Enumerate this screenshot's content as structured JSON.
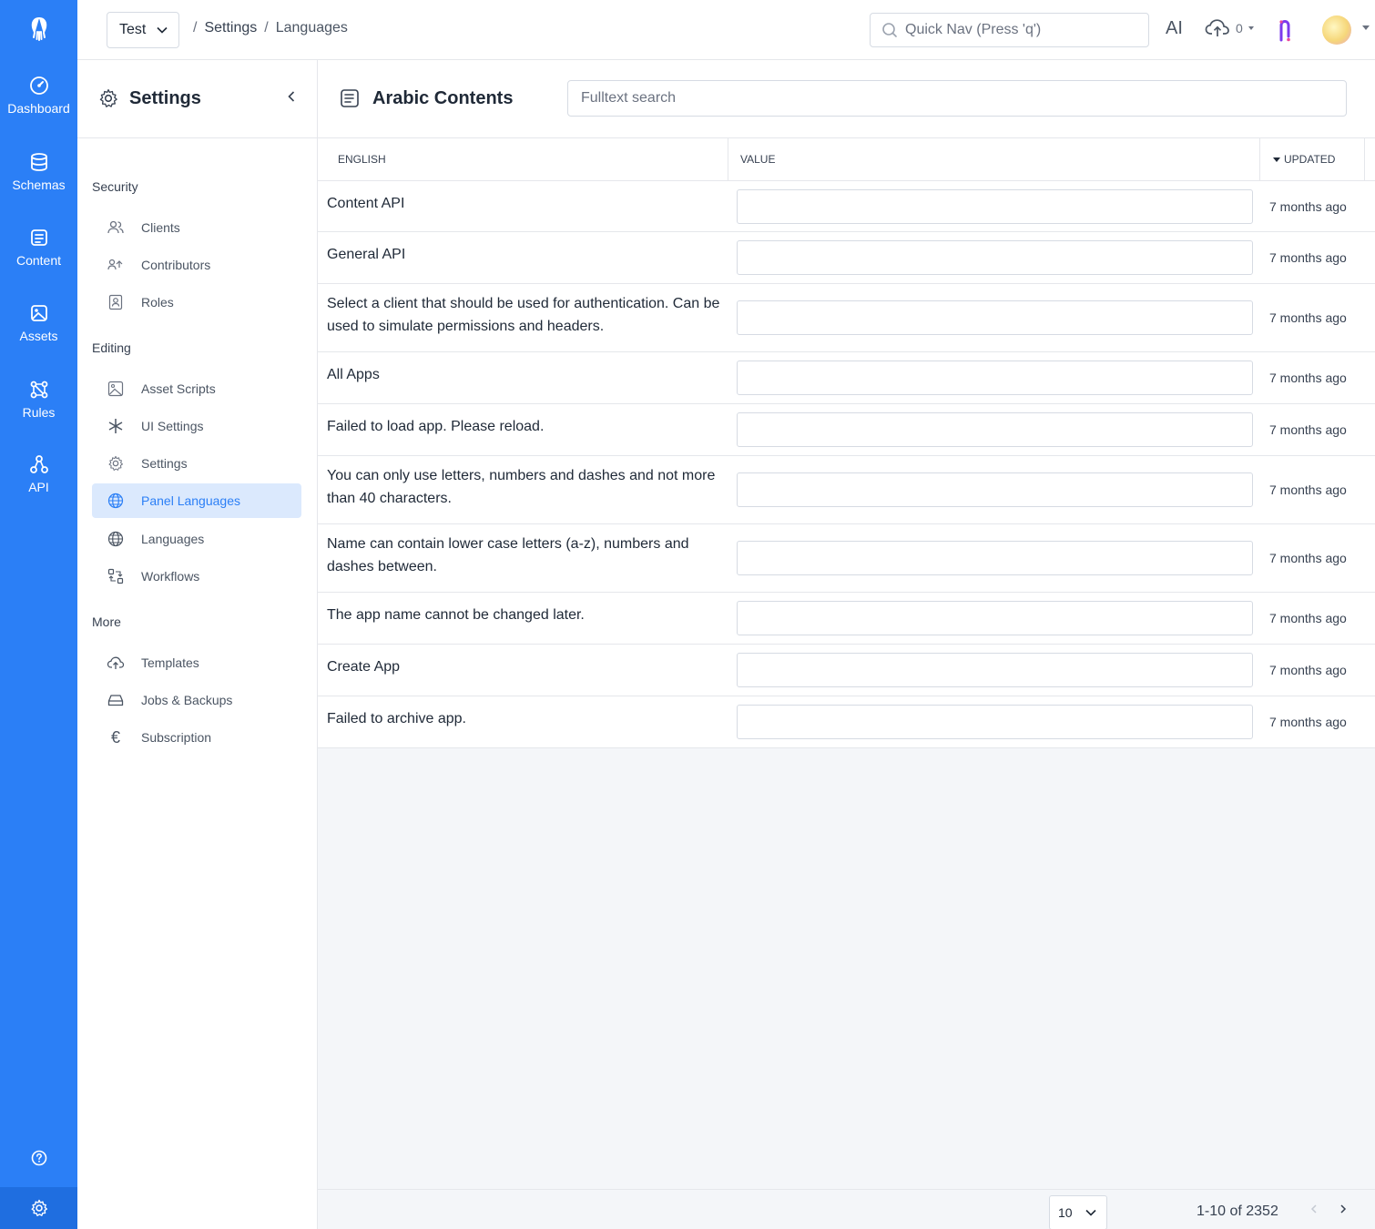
{
  "rail": {
    "items": [
      {
        "label": "Dashboard",
        "icon": "dashboard-icon"
      },
      {
        "label": "Schemas",
        "icon": "schemas-icon"
      },
      {
        "label": "Content",
        "icon": "content-icon"
      },
      {
        "label": "Assets",
        "icon": "assets-icon"
      },
      {
        "label": "Rules",
        "icon": "rules-icon"
      },
      {
        "label": "API",
        "icon": "api-icon"
      }
    ]
  },
  "topbar": {
    "app_name": "Test",
    "breadcrumb": {
      "sep": "/",
      "section": "Settings",
      "page": "Languages"
    },
    "quicknav_placeholder": "Quick Nav (Press 'q')",
    "ai_label": "AI",
    "upload_count": "0"
  },
  "sidebar": {
    "title": "Settings",
    "groups": [
      {
        "label": "Security"
      },
      {
        "label": "Editing"
      },
      {
        "label": "More"
      }
    ],
    "items": [
      {
        "label": "Clients"
      },
      {
        "label": "Contributors"
      },
      {
        "label": "Roles"
      },
      {
        "label": "Asset Scripts"
      },
      {
        "label": "UI Settings"
      },
      {
        "label": "Settings"
      },
      {
        "label": "Panel Languages"
      },
      {
        "label": "Languages"
      },
      {
        "label": "Workflows"
      },
      {
        "label": "Templates"
      },
      {
        "label": "Jobs & Backups"
      },
      {
        "label": "Subscription"
      }
    ]
  },
  "main": {
    "title": "Arabic Contents",
    "search_placeholder": "Fulltext search",
    "columns": {
      "english": "English",
      "value": "Value",
      "updated": "Updated"
    },
    "rows": [
      {
        "english": "Content API",
        "value": "",
        "updated": "7 months ago"
      },
      {
        "english": "General API",
        "value": "",
        "updated": "7 months ago"
      },
      {
        "english": "Select a client that should be used for authentication. Can be used to simulate permissions and headers.",
        "value": "",
        "updated": "7 months ago"
      },
      {
        "english": "All Apps",
        "value": "",
        "updated": "7 months ago"
      },
      {
        "english": "Failed to load app. Please reload.",
        "value": "",
        "updated": "7 months ago"
      },
      {
        "english": "You can only use letters, numbers and dashes and not more than 40 characters.",
        "value": "",
        "updated": "7 months ago"
      },
      {
        "english": "Name can contain lower case letters (a-z), numbers and dashes between.",
        "value": "",
        "updated": "7 months ago"
      },
      {
        "english": "The app name cannot be changed later.",
        "value": "",
        "updated": "7 months ago"
      },
      {
        "english": "Create App",
        "value": "",
        "updated": "7 months ago"
      },
      {
        "english": "Failed to archive app.",
        "value": "",
        "updated": "7 months ago"
      }
    ]
  },
  "footer": {
    "page_size": "10",
    "page_info": "1-10 of 2352"
  }
}
